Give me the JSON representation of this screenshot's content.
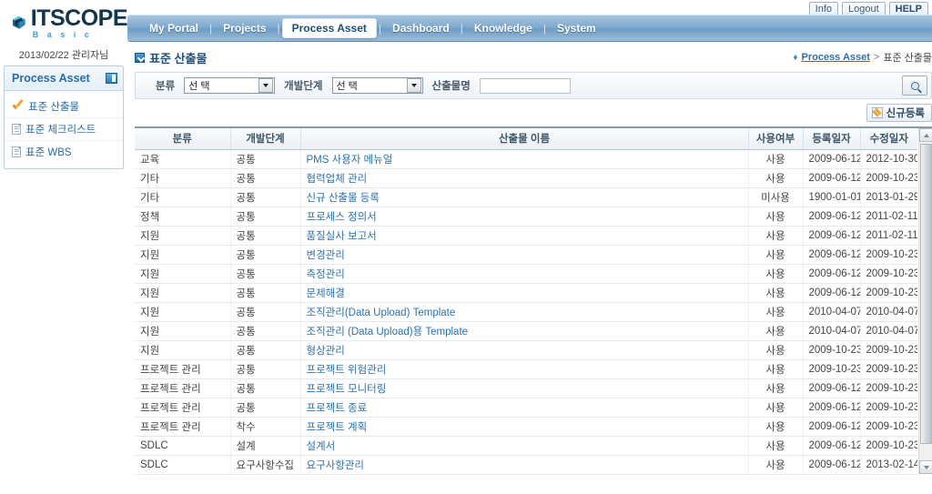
{
  "brand": {
    "name": "ITSCOPE",
    "tagline": "B a s i c",
    "logo_icon": "itscope-cube-logo"
  },
  "util": {
    "info_label": "Info",
    "logout_label": "Logout",
    "help_label": "HELP"
  },
  "nav": {
    "items": [
      {
        "label": "My Portal",
        "active": false
      },
      {
        "label": "Projects",
        "active": false
      },
      {
        "label": "Process Asset",
        "active": true
      },
      {
        "label": "Dashboard",
        "active": false
      },
      {
        "label": "Knowledge",
        "active": false
      },
      {
        "label": "System",
        "active": false
      }
    ],
    "separator": "|"
  },
  "sidebar": {
    "user_line": "2013/02/22 관리자님",
    "title": "Process Asset",
    "panel_icon": "collapse-panel-icon",
    "items": [
      {
        "label": "표준 산출물",
        "icon": "orange-check-icon",
        "active": true
      },
      {
        "label": "표준 체크리스트",
        "icon": "document-icon",
        "active": false
      },
      {
        "label": "표준 WBS",
        "icon": "document-icon",
        "active": false
      }
    ]
  },
  "page": {
    "title": "표준 산출물",
    "title_icon": "page-bullet-icon",
    "breadcrumb": {
      "dot": "♦",
      "root": "Process Asset",
      "separator": ">",
      "current": "표준 산출물"
    }
  },
  "filter": {
    "category_label": "분류",
    "category_value": "선 택",
    "stage_label": "개발단계",
    "stage_value": "선 택",
    "name_label": "산출물명",
    "name_value": "",
    "name_placeholder": "",
    "search_icon": "magnifier-icon"
  },
  "actions": {
    "new_label": "신규등록",
    "new_icon": "pencil-icon"
  },
  "table": {
    "columns": [
      "분류",
      "개발단계",
      "산출물 이름",
      "사용여부",
      "등록일자",
      "수정일자"
    ],
    "rows": [
      {
        "category": "교육",
        "stage": "공통",
        "name": "PMS 사용자 메뉴얼",
        "use": "사용",
        "registered": "2009-06-12",
        "modified": "2012-10-30"
      },
      {
        "category": "기타",
        "stage": "공통",
        "name": "협력업체 관리",
        "use": "사용",
        "registered": "2009-06-12",
        "modified": "2009-10-23"
      },
      {
        "category": "기타",
        "stage": "공통",
        "name": "신규 산출물 등록",
        "use": "미사용",
        "registered": "1900-01-01",
        "modified": "2013-01-29"
      },
      {
        "category": "정책",
        "stage": "공통",
        "name": "프로세스 정의서",
        "use": "사용",
        "registered": "2009-06-12",
        "modified": "2011-02-11"
      },
      {
        "category": "지원",
        "stage": "공통",
        "name": "품질실사 보고서",
        "use": "사용",
        "registered": "2009-06-12",
        "modified": "2011-02-11"
      },
      {
        "category": "지원",
        "stage": "공통",
        "name": "변경관리",
        "use": "사용",
        "registered": "2009-06-12",
        "modified": "2009-10-23"
      },
      {
        "category": "지원",
        "stage": "공통",
        "name": "측정관리",
        "use": "사용",
        "registered": "2009-06-12",
        "modified": "2009-10-23"
      },
      {
        "category": "지원",
        "stage": "공통",
        "name": "문제해결",
        "use": "사용",
        "registered": "2009-06-12",
        "modified": "2009-10-23"
      },
      {
        "category": "지원",
        "stage": "공통",
        "name": "조직관리(Data Upload) Template",
        "use": "사용",
        "registered": "2010-04-07",
        "modified": "2010-04-07"
      },
      {
        "category": "지원",
        "stage": "공통",
        "name": "조직관리 (Data Upload)용 Template",
        "use": "사용",
        "registered": "2010-04-07",
        "modified": "2010-04-07"
      },
      {
        "category": "지원",
        "stage": "공통",
        "name": "형상관리",
        "use": "사용",
        "registered": "2009-10-23",
        "modified": "2009-10-23"
      },
      {
        "category": "프로젝트 관리",
        "stage": "공통",
        "name": "프로젝트 위험관리",
        "use": "사용",
        "registered": "2009-10-23",
        "modified": "2009-10-23"
      },
      {
        "category": "프로젝트 관리",
        "stage": "공통",
        "name": "프로젝트 모니터링",
        "use": "사용",
        "registered": "2009-06-12",
        "modified": "2009-10-23"
      },
      {
        "category": "프로젝트 관리",
        "stage": "공통",
        "name": "프로젝트 종료",
        "use": "사용",
        "registered": "2009-06-12",
        "modified": "2009-10-23"
      },
      {
        "category": "프로젝트 관리",
        "stage": "착수",
        "name": "프로젝트 계획",
        "use": "사용",
        "registered": "2009-06-12",
        "modified": "2009-10-23"
      },
      {
        "category": "SDLC",
        "stage": "설계",
        "name": "설계서",
        "use": "사용",
        "registered": "2009-06-12",
        "modified": "2009-10-23"
      },
      {
        "category": "SDLC",
        "stage": "요구사항수집",
        "name": "요구사항관리",
        "use": "사용",
        "registered": "2009-06-12",
        "modified": "2013-02-14"
      }
    ]
  },
  "scrollbar": {
    "up_icon": "scroll-up-arrow-icon",
    "down_icon": "scroll-down-arrow-icon",
    "thumb": "scroll-thumb"
  },
  "colors": {
    "nav_blue": "#7fa9ce",
    "link_blue": "#2b72ab",
    "title_blue": "#1d4f78",
    "accent_orange": "#f0a13a"
  }
}
